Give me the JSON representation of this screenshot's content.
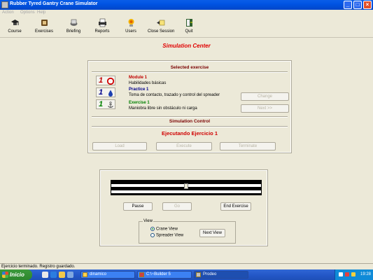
{
  "window": {
    "title": "Rubber Tyred Gantry Crane Simulator"
  },
  "menu": [
    "Action",
    "Options",
    "Help"
  ],
  "toolbar": [
    {
      "label": "Course",
      "icon": "course-icon"
    },
    {
      "label": "Exercises",
      "icon": "exercises-icon"
    },
    {
      "label": "Briefing",
      "icon": "briefing-icon"
    },
    {
      "label": "Reports",
      "icon": "reports-icon"
    },
    {
      "label": "Users",
      "icon": "users-icon"
    },
    {
      "label": "Close Session",
      "icon": "close-session-icon"
    },
    {
      "label": "Quit",
      "icon": "quit-icon"
    }
  ],
  "page_title": "Simulation Center",
  "selected_exercise": {
    "title": "Selected exercise",
    "module": {
      "number": "1",
      "head": "Module 1",
      "desc": "Habilidades básicas",
      "color": "#c00000"
    },
    "practice": {
      "number": "1",
      "head": "Practice 1",
      "desc": "Toma de contacto, trazado y control del spreader",
      "color": "#00008b"
    },
    "exercise": {
      "number": "1",
      "head": "Exercise 1",
      "desc": "Maniobra libre sin obstáculo ni carga",
      "color": "#008000"
    },
    "change_label": "Change",
    "next_label": "Next >>"
  },
  "simulation_control": {
    "title": "Simulation Control",
    "status": "Ejecutando Ejercicio 1",
    "buttons": [
      "Load",
      "Execute",
      "Terminate"
    ]
  },
  "playback": {
    "pause_label": "Pause",
    "go_label": "Go",
    "end_label": "End Exercise",
    "progress": 0.5
  },
  "view": {
    "legend": "View",
    "options": [
      {
        "label": "Crane View",
        "selected": true
      },
      {
        "label": "Spreader View",
        "selected": false
      }
    ],
    "next_view_label": "Next View"
  },
  "status_bar": "Ejercicio terminado. Registro guardado.",
  "taskbar": {
    "start_label": "Inicio",
    "tasks": [
      "dinamico",
      "C:\\~Builder 5",
      "Prodeo"
    ],
    "clock": "19:28"
  },
  "colors": {
    "title_red": "#e00000",
    "section_title": "#7a0000",
    "running_red": "#d00000",
    "titlebar_blue": "#0054e3"
  }
}
